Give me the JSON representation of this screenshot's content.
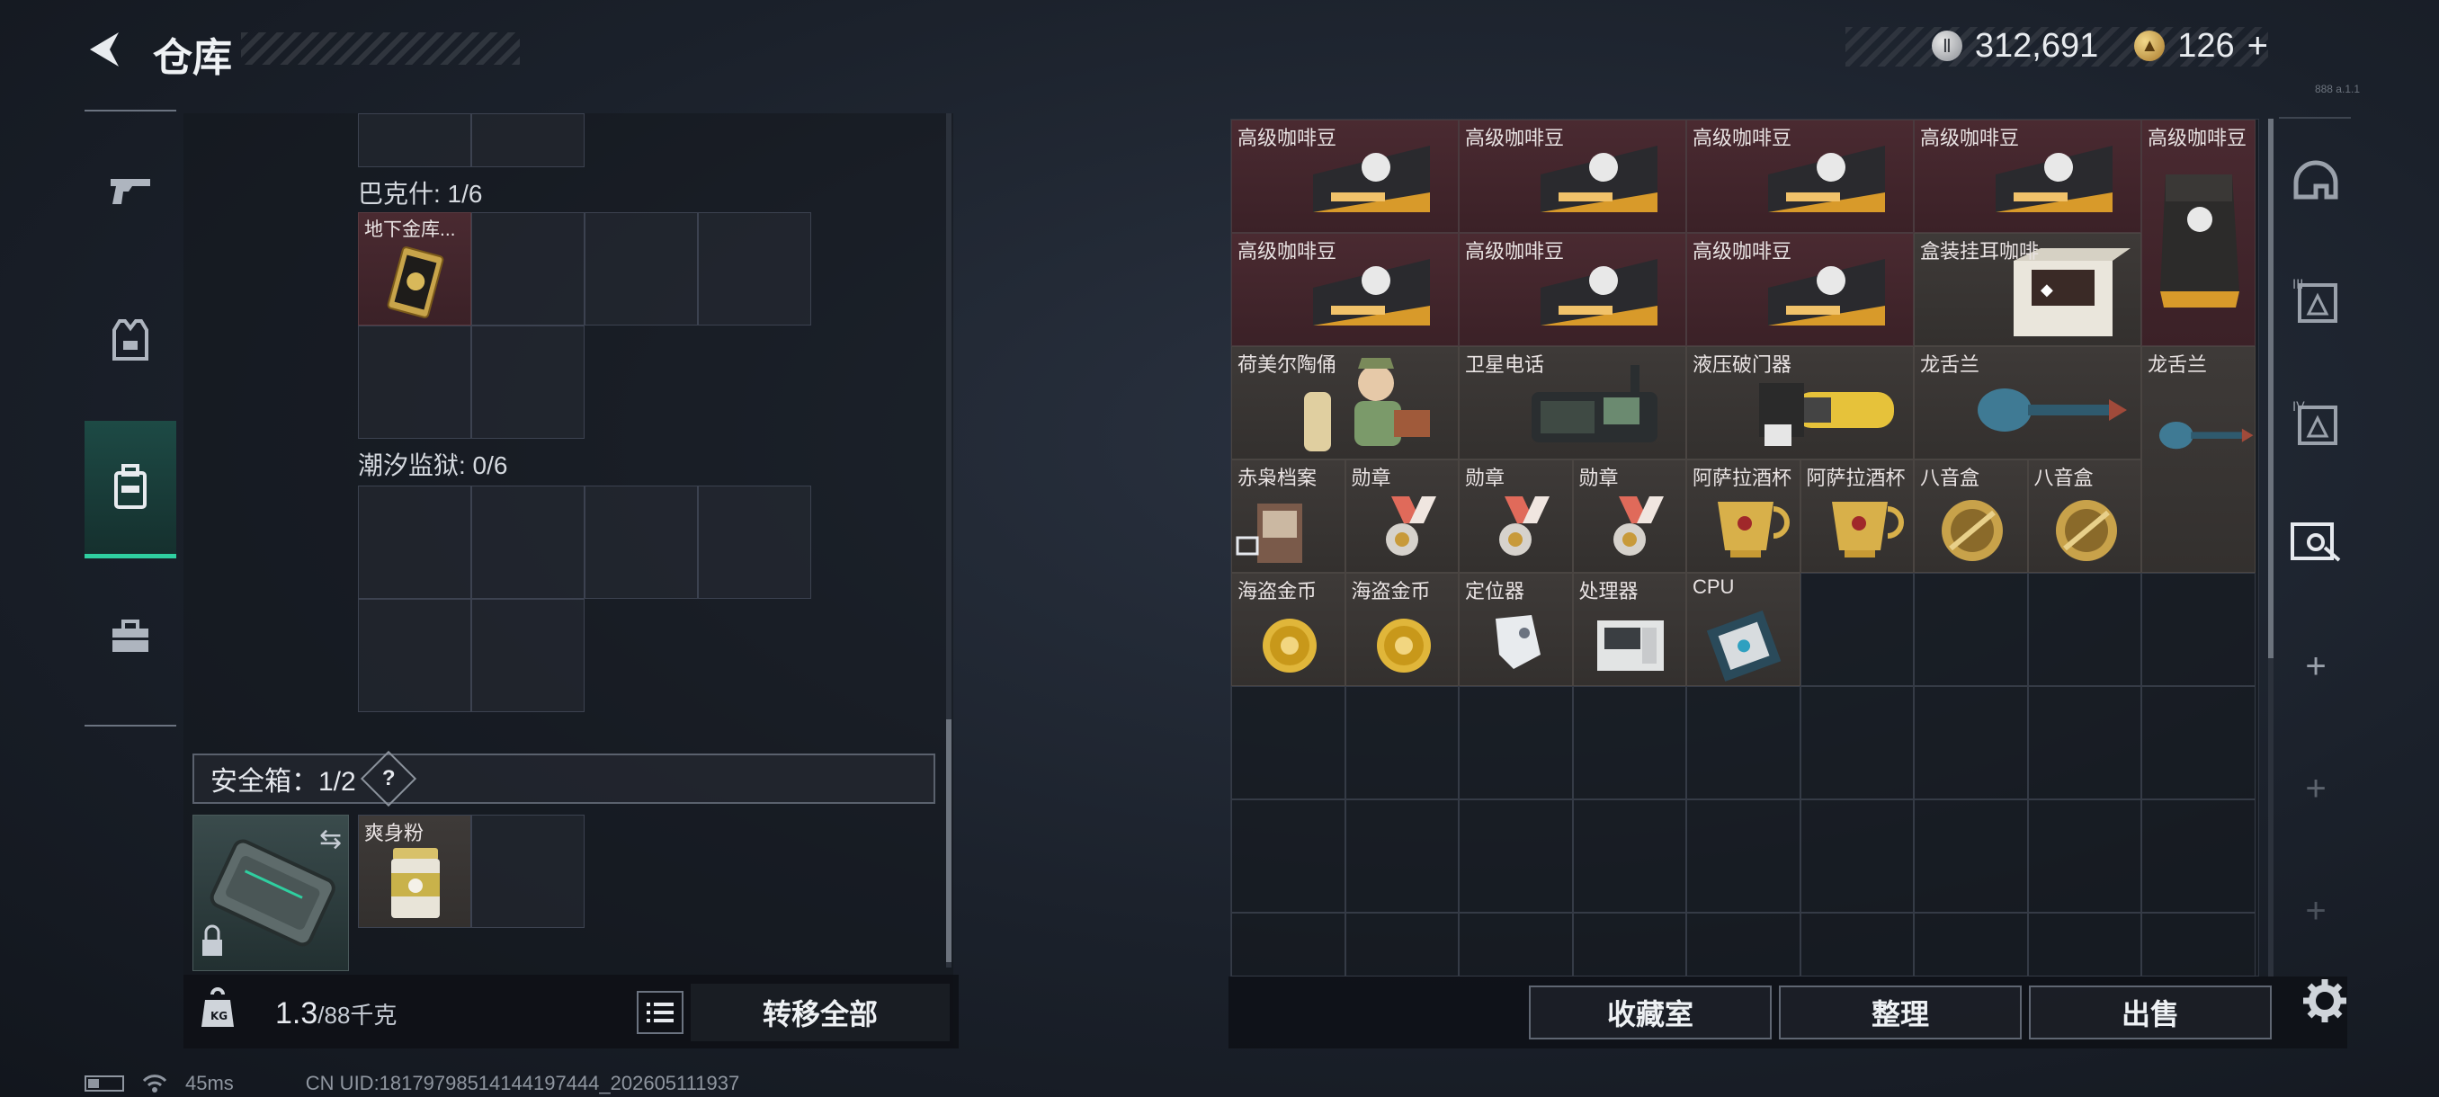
{
  "header": {
    "back_icon": "back-arrow-icon",
    "title": "仓库",
    "silver_amount": "312,691",
    "gold_amount": "126",
    "gold_add": "+",
    "version_tag": "888 a.1.1"
  },
  "left_tabs": [
    {
      "icon": "gun-icon"
    },
    {
      "icon": "vest-icon"
    },
    {
      "icon": "backpack-icon",
      "active": true
    },
    {
      "icon": "toolbox-icon"
    }
  ],
  "containers": {
    "bakeshi_label": "巴克什: 1/6",
    "bakeshi_item": "地下金库...",
    "chaoxi_label": "潮汐监狱: 0/6",
    "safebox_label": "安全箱：1/2",
    "safebox_help": "?",
    "safebox_item": "爽身粉"
  },
  "footer_left": {
    "weight_current": "1.3",
    "weight_max": "/88千克",
    "weight_icon_text": "KG",
    "transfer_all": "转移全部"
  },
  "grid_items": [
    {
      "label": "高级咖啡豆",
      "art": "coffee",
      "style": "red"
    },
    {
      "label": "高级咖啡豆",
      "art": "coffee",
      "style": "red"
    },
    {
      "label": "高级咖啡豆",
      "art": "coffee",
      "style": "red"
    },
    {
      "label": "高级咖啡豆",
      "art": "coffee",
      "style": "red"
    },
    {
      "label": "高级咖啡豆",
      "art": "coffeebag",
      "style": "red"
    },
    {
      "label": "高级咖啡豆",
      "art": "coffee",
      "style": "red"
    },
    {
      "label": "高级咖啡豆",
      "art": "coffee",
      "style": "red"
    },
    {
      "label": "高级咖啡豆",
      "art": "coffee",
      "style": "red"
    },
    {
      "label": "盒装挂耳咖啡",
      "art": "box",
      "style": "brown"
    },
    {
      "label": "荷美尔陶俑",
      "art": "figurine",
      "style": "brown"
    },
    {
      "label": "卫星电话",
      "art": "phone",
      "style": "brown"
    },
    {
      "label": "液压破门器",
      "art": "hydraulic",
      "style": "brown"
    },
    {
      "label": "龙舌兰",
      "art": "bottle",
      "style": "brown"
    },
    {
      "label": "龙舌兰",
      "art": "bottle",
      "style": "brown"
    },
    {
      "label": "赤枭档案",
      "art": "file",
      "style": "brown"
    },
    {
      "label": "勋章",
      "art": "medal",
      "style": "brown"
    },
    {
      "label": "勋章",
      "art": "medal",
      "style": "brown"
    },
    {
      "label": "勋章",
      "art": "medal",
      "style": "brown"
    },
    {
      "label": "阿萨拉酒杯",
      "art": "cup",
      "style": "brown"
    },
    {
      "label": "阿萨拉酒杯",
      "art": "cup",
      "style": "brown"
    },
    {
      "label": "八音盒",
      "art": "musicbox",
      "style": "brown"
    },
    {
      "label": "八音盒",
      "art": "musicbox",
      "style": "brown"
    },
    {
      "label": "海盗金币",
      "art": "coin",
      "style": "brown"
    },
    {
      "label": "海盗金币",
      "art": "coin",
      "style": "brown"
    },
    {
      "label": "定位器",
      "art": "tracker",
      "style": "brown"
    },
    {
      "label": "处理器",
      "art": "processor",
      "style": "brown"
    },
    {
      "label": "CPU",
      "art": "cpu",
      "style": "brown"
    }
  ],
  "right_tabs": [
    {
      "icon": "helmet-icon"
    },
    {
      "icon": "armor-3-icon"
    },
    {
      "icon": "armor-4-icon"
    },
    {
      "icon": "case-icon"
    },
    {
      "icon": "add-icon",
      "text": "+"
    },
    {
      "icon": "add-icon",
      "text": "+"
    },
    {
      "icon": "add-icon",
      "text": "+"
    }
  ],
  "footer_right": {
    "collection": "收藏室",
    "sort": "整理",
    "sell": "出售"
  },
  "status": {
    "ping": "45ms",
    "uid": "CN UID:18179798514144197444_202605111937"
  },
  "colors": {
    "accent": "#2fcfa0",
    "item_red": "#4a2a31",
    "item_brown": "#3e3a38"
  }
}
